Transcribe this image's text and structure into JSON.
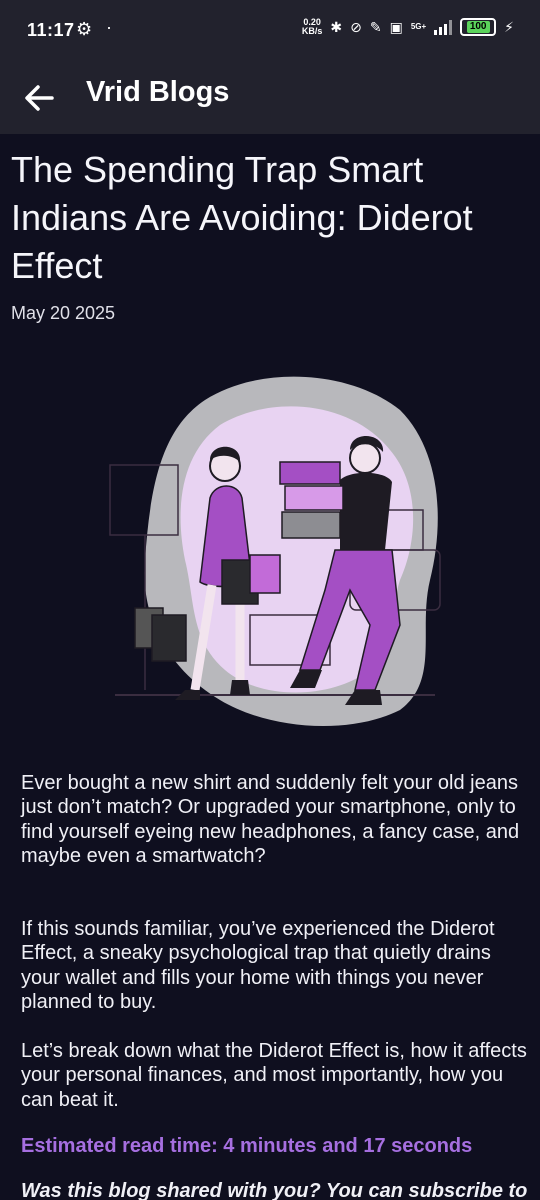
{
  "status": {
    "time": "11:17",
    "kbs_top": "0.20",
    "kbs_bottom": "KB/s",
    "network": "5G+",
    "battery": "100"
  },
  "appbar": {
    "title": "Vrid Blogs"
  },
  "post": {
    "title": "The Spending Trap Smart Indians Are Avoiding: Diderot Effect",
    "date": "May 20 2025",
    "paragraphs": [
      "Ever bought a new shirt and suddenly felt your old jeans just don’t match? Or upgraded your smartphone, only to find yourself eyeing new headphones, a fancy case, and maybe even a smartwatch?",
      "If this sounds familiar, you’ve experienced the Diderot Effect, a sneaky psychological trap that quietly drains your wallet and fills your home with things you never planned to buy.",
      "Let’s break down what the Diderot Effect is, how it affects your personal finances, and most importantly, how you can beat it."
    ],
    "read_time": "Estimated read time: 4 minutes and 17 seconds",
    "shared_text": "Was this blog shared with you? You can subscribe to"
  },
  "colors": {
    "background": "#0f0f1f",
    "appbar": "#22222d",
    "accent": "#a66fe0",
    "blob_light": "#e8d3f2",
    "blob_grey": "#b8b8bc",
    "purple": "#a44fc4"
  }
}
